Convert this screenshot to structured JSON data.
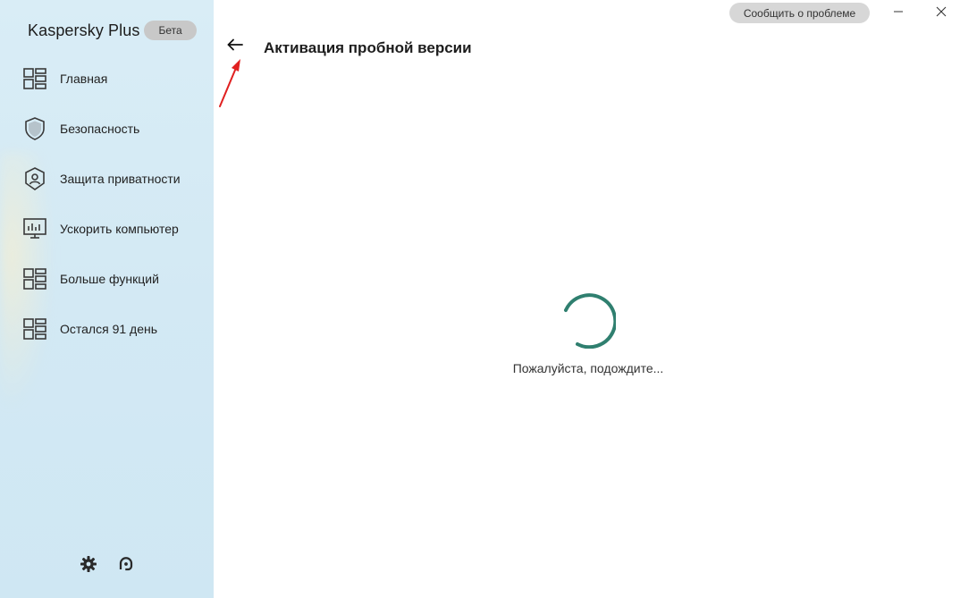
{
  "app": {
    "name": "Kaspersky Plus",
    "badge": "Бета"
  },
  "sidebar": {
    "items": [
      {
        "label": "Главная",
        "icon": "home-grid-icon"
      },
      {
        "label": "Безопасность",
        "icon": "shield-icon"
      },
      {
        "label": "Защита приватности",
        "icon": "privacy-shield-icon"
      },
      {
        "label": "Ускорить компьютер",
        "icon": "monitor-chart-icon"
      },
      {
        "label": "Больше функций",
        "icon": "more-grid-icon"
      },
      {
        "label": "Остался 91 день",
        "icon": "license-grid-icon"
      }
    ],
    "bottom_icons": [
      "gear-icon",
      "support-icon"
    ]
  },
  "header": {
    "report_label": "Сообщить о проблеме",
    "title": "Активация пробной версии"
  },
  "main": {
    "loading_text": "Пожалуйста, подождите..."
  },
  "colors": {
    "accent": "#2f7f6f",
    "annotation": "#e02020",
    "sidebar_bg": "#d3e9f4"
  }
}
